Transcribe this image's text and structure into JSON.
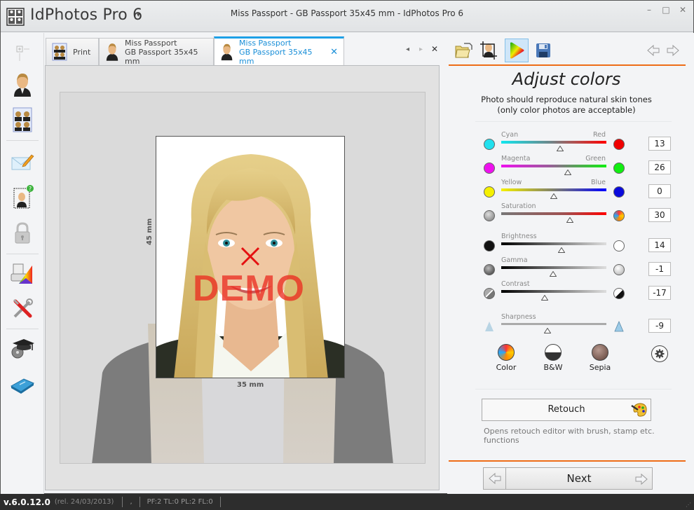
{
  "app": {
    "name": "IdPhotos Pro 6",
    "window_title": "Miss Passport - GB Passport 35x45 mm - IdPhotos Pro 6",
    "menu_caret": "▾",
    "controls": {
      "minimize": "–",
      "maximize": "□",
      "close": "✕"
    }
  },
  "sidebar": {
    "items": [
      {
        "icon": "person-icon",
        "label": "Person"
      },
      {
        "icon": "print-sheet-icon",
        "label": "Print sheet"
      },
      {
        "icon": "email-icon",
        "label": "Email"
      },
      {
        "icon": "photo-check-icon",
        "label": "Check photo"
      },
      {
        "icon": "lock-icon",
        "label": "Lock"
      },
      {
        "icon": "color-profile-icon",
        "label": "Color profile"
      },
      {
        "icon": "tools-icon",
        "label": "Tools"
      },
      {
        "icon": "tutorial-icon",
        "label": "Tutorials"
      },
      {
        "icon": "manual-icon",
        "label": "Manual"
      }
    ]
  },
  "tabs": [
    {
      "label": "Print",
      "label2": "",
      "icon": "print-sheet-icon",
      "active": false
    },
    {
      "label": "Miss Passport",
      "label2": "GB Passport 35x45 mm",
      "icon": "person-icon",
      "active": false
    },
    {
      "label": "Miss Passport",
      "label2": "GB Passport 35x45 mm",
      "icon": "person-icon",
      "active": true,
      "close": "✕"
    }
  ],
  "tab_nav": {
    "prev": "◂",
    "next": "▸",
    "close": "✕"
  },
  "workspace": {
    "height_label": "45 mm",
    "width_label": "35 mm",
    "watermark": "DEMO"
  },
  "right_toolbar": {
    "tools": [
      {
        "name": "open-photo",
        "icon": "folder-open-icon"
      },
      {
        "name": "crop",
        "icon": "crop-icon"
      },
      {
        "name": "adjust-colors",
        "icon": "color-gamut-icon",
        "selected": true
      },
      {
        "name": "save",
        "icon": "save-icon"
      }
    ],
    "back": "⇦",
    "forward": "⇨"
  },
  "panel": {
    "title": "Adjust colors",
    "subtitle_line1": "Photo should reproduce natural skin tones",
    "subtitle_line2": "(only color photos are acceptable)",
    "sliders": [
      {
        "id": "cyan-red",
        "left_label": "Cyan",
        "right_label": "Red",
        "value": "13",
        "position": 0.56,
        "left_color": "#22e0ee",
        "right_color": "#f00000",
        "track": "linear-gradient(90deg,#11e6ee,#6a8a8e 45%,#b25050 70%,#ff0000)"
      },
      {
        "id": "magenta-green",
        "left_label": "Magenta",
        "right_label": "Green",
        "value": "26",
        "position": 0.63,
        "left_color": "#ee11ee",
        "right_color": "#11ee11",
        "track": "linear-gradient(90deg,#ee11ee,#9c5a9c 45%,#5aa05a 70%,#11ee11)"
      },
      {
        "id": "yellow-blue",
        "left_label": "Yellow",
        "right_label": "Blue",
        "value": "0",
        "position": 0.5,
        "left_color": "#f5f000",
        "right_color": "#0a0adc",
        "track": "linear-gradient(90deg,#f5f000,#8a8a60 45%,#5a5a9a 65%,#0000ff)"
      },
      {
        "id": "saturation",
        "left_label": "Saturation",
        "right_label": "",
        "value": "30",
        "position": 0.65,
        "left_color": "#999999",
        "right_color": "multicolor",
        "track": "linear-gradient(90deg,#777,#a05050 60%,#ff0000)"
      },
      {
        "id": "brightness",
        "left_label": "Brightness",
        "right_label": "",
        "value": "14",
        "position": 0.57,
        "left_color": "#111111",
        "right_color": "#ffffff",
        "track": "linear-gradient(90deg,#000,#888 60%,#ddd)"
      },
      {
        "id": "gamma",
        "left_label": "Gamma",
        "right_label": "",
        "value": "-1",
        "position": 0.49,
        "left_color": "#555555",
        "right_color": "#cccccc",
        "track": "linear-gradient(90deg,#000,#888 60%,#ddd)"
      },
      {
        "id": "contrast",
        "left_label": "Contrast",
        "right_label": "",
        "value": "-17",
        "position": 0.41,
        "left_color": "#888888",
        "right_color": "half",
        "track": "linear-gradient(90deg,#000,#888 60%,#ddd)"
      },
      {
        "id": "sharpness",
        "left_label": "Sharpness",
        "right_label": "",
        "value": "-9",
        "position": 0.44,
        "left_color": "#aacde0",
        "right_color": "#8cc8ea",
        "track": "linear-gradient(90deg,#aaa,#aaa)"
      }
    ],
    "presets": [
      {
        "label": "Color"
      },
      {
        "label": "B&W"
      },
      {
        "label": "Sepia"
      }
    ],
    "retouch_label": "Retouch",
    "retouch_description": "Opens retouch editor with brush, stamp etc. functions",
    "next_label": "Next"
  },
  "status": {
    "version": "v.6.0.12.0",
    "release": "(rel. 24/03/2013)",
    "middle": ",",
    "counters": "PF:2 TL:0 PL:2 FL:0"
  }
}
